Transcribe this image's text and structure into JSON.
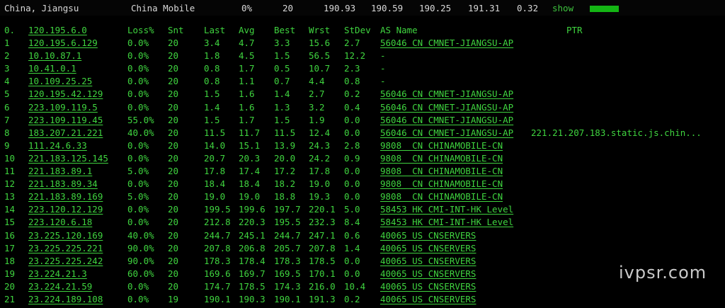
{
  "header": {
    "location": "China, Jiangsu",
    "isp": "China Mobile",
    "loss": "0%",
    "snt": "20",
    "last": "190.93",
    "avg": "190.59",
    "best": "190.25",
    "wrst": "191.31",
    "stdev": "0.32",
    "show_label": "show"
  },
  "table": {
    "columns": {
      "hop": "0.",
      "loss": "Loss%",
      "snt": "Snt",
      "last": "Last",
      "avg": "Avg",
      "best": "Best",
      "wrst": "Wrst",
      "stdev": "StDev",
      "as": "AS Name",
      "ptr": "PTR"
    },
    "hop0_host": "120.195.6.0",
    "rows": [
      {
        "hop": "1",
        "host": "120.195.6.129",
        "loss": "0.0%",
        "snt": "20",
        "last": "3.4",
        "avg": "4.7",
        "best": "3.3",
        "wrst": "15.6",
        "stdev": "2.7",
        "as": "56046 CN CMNET-JIANGSU-AP",
        "ptr": ""
      },
      {
        "hop": "2",
        "host": "10.10.87.1",
        "loss": "0.0%",
        "snt": "20",
        "last": "1.8",
        "avg": "4.5",
        "best": "1.5",
        "wrst": "56.5",
        "stdev": "12.2",
        "as": "-",
        "ptr": ""
      },
      {
        "hop": "3",
        "host": "10.41.0.1",
        "loss": "0.0%",
        "snt": "20",
        "last": "0.8",
        "avg": "1.7",
        "best": "0.5",
        "wrst": "10.7",
        "stdev": "2.3",
        "as": "-",
        "ptr": ""
      },
      {
        "hop": "4",
        "host": "10.109.25.25",
        "loss": "0.0%",
        "snt": "20",
        "last": "0.8",
        "avg": "1.1",
        "best": "0.7",
        "wrst": "4.4",
        "stdev": "0.8",
        "as": "-",
        "ptr": ""
      },
      {
        "hop": "5",
        "host": "120.195.42.129",
        "loss": "0.0%",
        "snt": "20",
        "last": "1.5",
        "avg": "1.6",
        "best": "1.4",
        "wrst": "2.7",
        "stdev": "0.2",
        "as": "56046 CN CMNET-JIANGSU-AP",
        "ptr": ""
      },
      {
        "hop": "6",
        "host": "223.109.119.5",
        "loss": "0.0%",
        "snt": "20",
        "last": "1.4",
        "avg": "1.6",
        "best": "1.3",
        "wrst": "3.2",
        "stdev": "0.4",
        "as": "56046 CN CMNET-JIANGSU-AP",
        "ptr": ""
      },
      {
        "hop": "7",
        "host": "223.109.119.45",
        "loss": "55.0%",
        "snt": "20",
        "last": "1.5",
        "avg": "1.7",
        "best": "1.5",
        "wrst": "1.9",
        "stdev": "0.0",
        "as": "56046 CN CMNET-JIANGSU-AP",
        "ptr": ""
      },
      {
        "hop": "8",
        "host": "183.207.21.221",
        "loss": "40.0%",
        "snt": "20",
        "last": "11.5",
        "avg": "11.7",
        "best": "11.5",
        "wrst": "12.4",
        "stdev": "0.0",
        "as": "56046 CN CMNET-JIANGSU-AP",
        "ptr": "221.21.207.183.static.js.chin..."
      },
      {
        "hop": "9",
        "host": "111.24.6.33",
        "loss": "0.0%",
        "snt": "20",
        "last": "14.0",
        "avg": "15.1",
        "best": "13.9",
        "wrst": "24.3",
        "stdev": "2.8",
        "as": "9808  CN CHINAMOBILE-CN",
        "ptr": ""
      },
      {
        "hop": "10",
        "host": "221.183.125.145",
        "loss": "0.0%",
        "snt": "20",
        "last": "20.7",
        "avg": "20.3",
        "best": "20.0",
        "wrst": "24.2",
        "stdev": "0.9",
        "as": "9808  CN CHINAMOBILE-CN",
        "ptr": ""
      },
      {
        "hop": "11",
        "host": "221.183.89.1",
        "loss": "5.0%",
        "snt": "20",
        "last": "17.8",
        "avg": "17.4",
        "best": "17.2",
        "wrst": "17.8",
        "stdev": "0.0",
        "as": "9808  CN CHINAMOBILE-CN",
        "ptr": ""
      },
      {
        "hop": "12",
        "host": "221.183.89.34",
        "loss": "0.0%",
        "snt": "20",
        "last": "18.4",
        "avg": "18.4",
        "best": "18.2",
        "wrst": "19.0",
        "stdev": "0.0",
        "as": "9808  CN CHINAMOBILE-CN",
        "ptr": ""
      },
      {
        "hop": "13",
        "host": "221.183.89.169",
        "loss": "5.0%",
        "snt": "20",
        "last": "19.0",
        "avg": "19.0",
        "best": "18.8",
        "wrst": "19.3",
        "stdev": "0.0",
        "as": "9808  CN CHINAMOBILE-CN",
        "ptr": ""
      },
      {
        "hop": "14",
        "host": "223.120.12.129",
        "loss": "0.0%",
        "snt": "20",
        "last": "199.5",
        "avg": "199.6",
        "best": "197.7",
        "wrst": "220.1",
        "stdev": "5.0",
        "as": "58453 HK CMI-INT-HK Level",
        "ptr": ""
      },
      {
        "hop": "15",
        "host": "223.120.6.18",
        "loss": "0.0%",
        "snt": "20",
        "last": "212.8",
        "avg": "220.3",
        "best": "195.5",
        "wrst": "232.3",
        "stdev": "8.4",
        "as": "58453 HK CMI-INT-HK Level",
        "ptr": ""
      },
      {
        "hop": "16",
        "host": "23.225.120.169",
        "loss": "40.0%",
        "snt": "20",
        "last": "244.7",
        "avg": "245.1",
        "best": "244.7",
        "wrst": "247.1",
        "stdev": "0.6",
        "as": "40065 US CNSERVERS",
        "ptr": ""
      },
      {
        "hop": "17",
        "host": "23.225.225.221",
        "loss": "90.0%",
        "snt": "20",
        "last": "207.8",
        "avg": "206.8",
        "best": "205.7",
        "wrst": "207.8",
        "stdev": "1.4",
        "as": "40065 US CNSERVERS",
        "ptr": ""
      },
      {
        "hop": "18",
        "host": "23.225.225.242",
        "loss": "90.0%",
        "snt": "20",
        "last": "178.3",
        "avg": "178.4",
        "best": "178.3",
        "wrst": "178.5",
        "stdev": "0.0",
        "as": "40065 US CNSERVERS",
        "ptr": ""
      },
      {
        "hop": "19",
        "host": "23.224.21.3",
        "loss": "60.0%",
        "snt": "20",
        "last": "169.6",
        "avg": "169.7",
        "best": "169.5",
        "wrst": "170.1",
        "stdev": "0.0",
        "as": "40065 US CNSERVERS",
        "ptr": ""
      },
      {
        "hop": "20",
        "host": "23.224.21.59",
        "loss": "0.0%",
        "snt": "20",
        "last": "174.7",
        "avg": "178.5",
        "best": "174.3",
        "wrst": "216.0",
        "stdev": "10.4",
        "as": "40065 US CNSERVERS",
        "ptr": ""
      },
      {
        "hop": "21",
        "host": "23.224.189.108",
        "loss": "0.0%",
        "snt": "19",
        "last": "190.1",
        "avg": "190.3",
        "best": "190.1",
        "wrst": "191.3",
        "stdev": "0.2",
        "as": "40065 US CNSERVERS",
        "ptr": ""
      }
    ]
  },
  "watermark": "ivpsr.com",
  "colors": {
    "text": "#3fd43f",
    "header_text": "#d8d8d8",
    "background": "#000000",
    "bar": "#14b514"
  }
}
